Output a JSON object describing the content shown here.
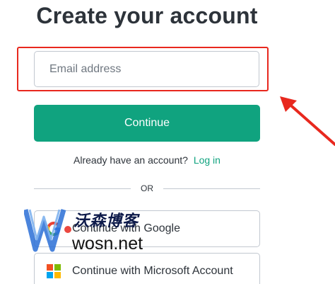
{
  "page": {
    "title": "Create your account"
  },
  "email": {
    "placeholder": "Email address",
    "value": ""
  },
  "continue_label": "Continue",
  "login": {
    "prompt": "Already have an account?",
    "link_label": "Log in"
  },
  "divider_label": "OR",
  "social": {
    "google_label": "Continue with Google",
    "microsoft_label": "Continue with Microsoft Account"
  },
  "watermark": {
    "name": "沃森博客",
    "url": "wosn.net"
  },
  "icons": {
    "annotation_arrow": "arrow-icon",
    "google": "google-icon",
    "microsoft": "microsoft-icon",
    "watermark_logo": "w-logo-icon"
  },
  "colors": {
    "accent": "#10a37f",
    "highlight": "#e8281e",
    "text": "#2d333a",
    "border": "#c2c8d0",
    "ms_red": "#f25022",
    "ms_green": "#7fba00",
    "ms_blue": "#00a4ef",
    "ms_yellow": "#ffb900",
    "watermark_blue": "#2a6fd6"
  }
}
